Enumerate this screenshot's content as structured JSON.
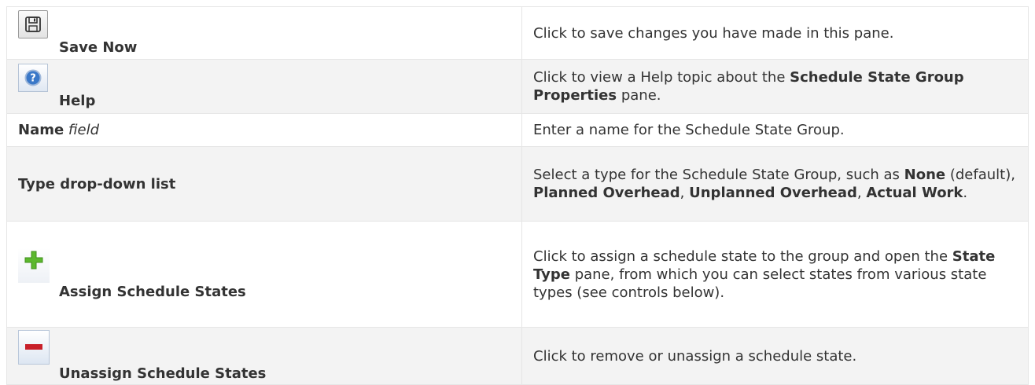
{
  "rows": [
    {
      "icon": "save-icon",
      "label": "Save Now",
      "description": "Click to save changes you have made in this pane."
    },
    {
      "icon": "help-icon",
      "label": "Help",
      "description_parts": [
        "Click to view a Help topic about the ",
        "Schedule State Group Properties",
        " pane."
      ]
    },
    {
      "label": "Name",
      "label_suffix": "field",
      "description": "Enter a name for the Schedule State Group."
    },
    {
      "label": "Type drop-down list",
      "description_parts": [
        "Select a type for the Schedule State Group, such as ",
        "None",
        " (default), ",
        "Planned Overhead",
        ", ",
        "Unplanned Overhead",
        ", ",
        "Actual Work",
        "."
      ]
    },
    {
      "icon": "plus-icon",
      "label": "Assign Schedule States",
      "description_parts": [
        "Click to assign a schedule state to the group and open the ",
        "State Type",
        " pane, from which you can select states from various state types (see controls below)."
      ]
    },
    {
      "icon": "minus-icon",
      "label": "Unassign Schedule States",
      "description": "Click to remove or unassign a schedule state."
    }
  ],
  "colors": {
    "row_alt": "#f3f3f3",
    "border": "#e6e6e6",
    "text": "#333333",
    "plus_green": "#5cb82e",
    "minus_red": "#c8202a",
    "help_blue": "#3a78c8"
  }
}
